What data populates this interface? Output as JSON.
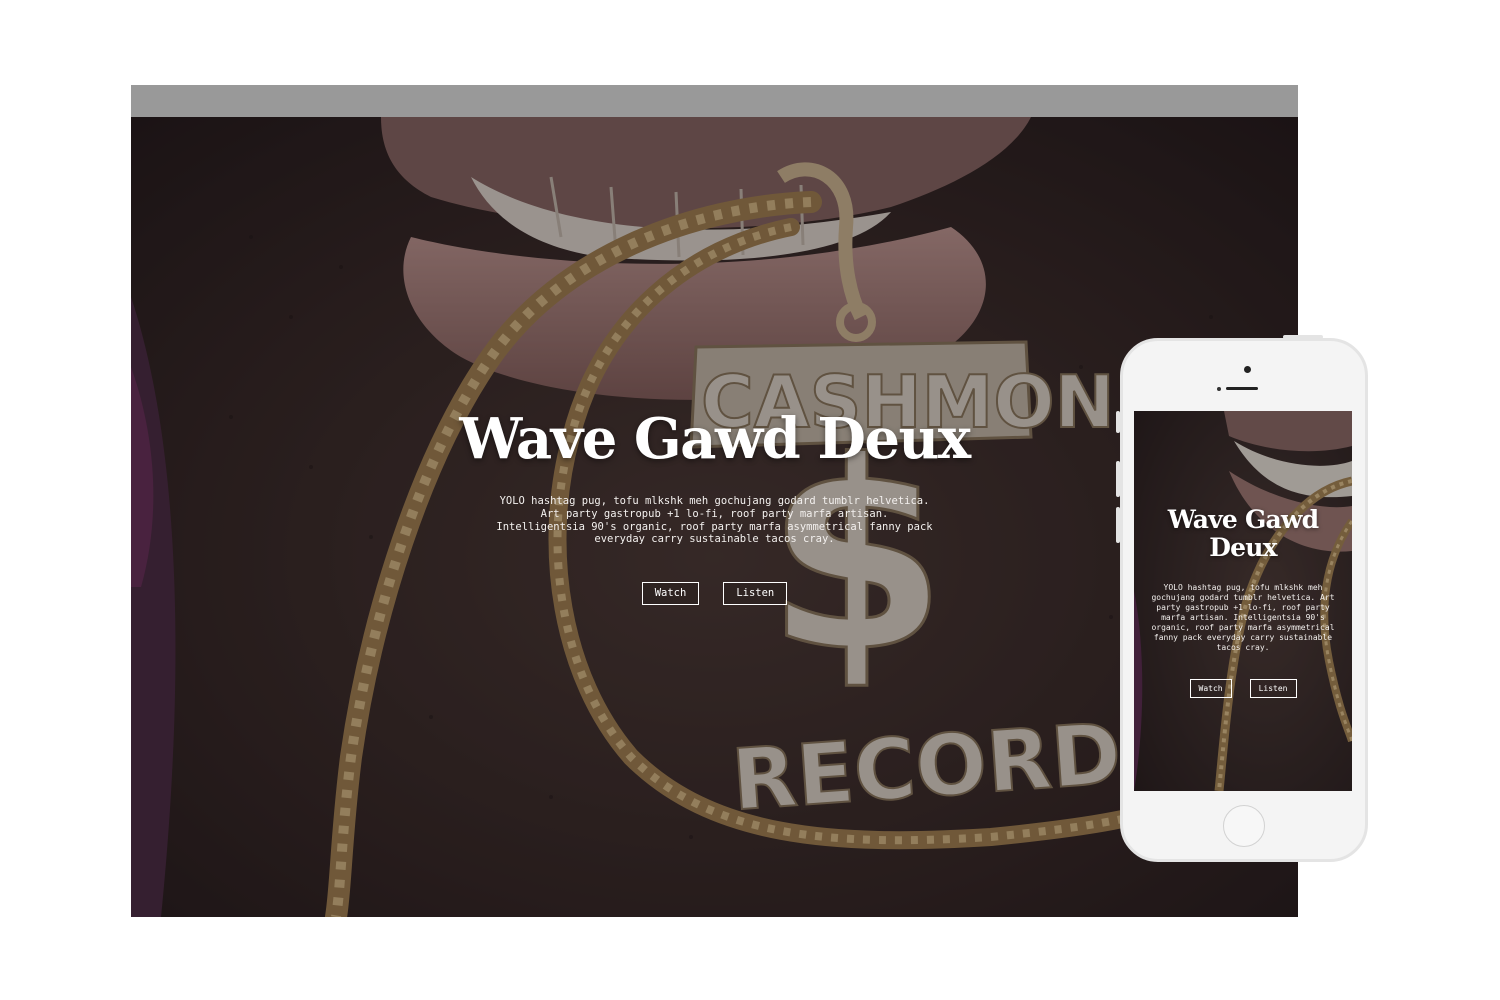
{
  "desktop": {
    "hero": {
      "title": "Wave Gawd Deux",
      "description": "YOLO hashtag pug, tofu mlkshk meh gochujang godard tumblr helvetica. Art party gastropub +1 lo-fi, roof party marfa artisan. Intelligentsia 90's organic, roof party marfa asymmetrical fanny pack everyday carry sustainable tacos cray.",
      "buttons": {
        "watch": "Watch",
        "listen": "Listen"
      },
      "image": {
        "subject": "close-up of mouth biting gold rope chain with pendant",
        "pendant_top": "CASHMONEY",
        "pendant_middle": "$",
        "pendant_bottom": "RECORDS"
      }
    }
  },
  "mobile": {
    "hero": {
      "title": "Wave Gawd Deux",
      "description": "YOLO hashtag pug, tofu mlkshk meh gochujang godard tumblr helvetica. Art party gastropub +1 lo-fi, roof party marfa artisan. Intelligentsia 90's organic, roof party marfa asymmetrical fanny pack everyday carry sustainable tacos cray.",
      "buttons": {
        "watch": "Watch",
        "listen": "Listen"
      }
    }
  },
  "colors": {
    "browser_bar": "#999999",
    "overlay_text": "#ffffff",
    "skin_dark": "#2f2523",
    "gold": "#c9a86a",
    "lip": "#b58c84"
  }
}
